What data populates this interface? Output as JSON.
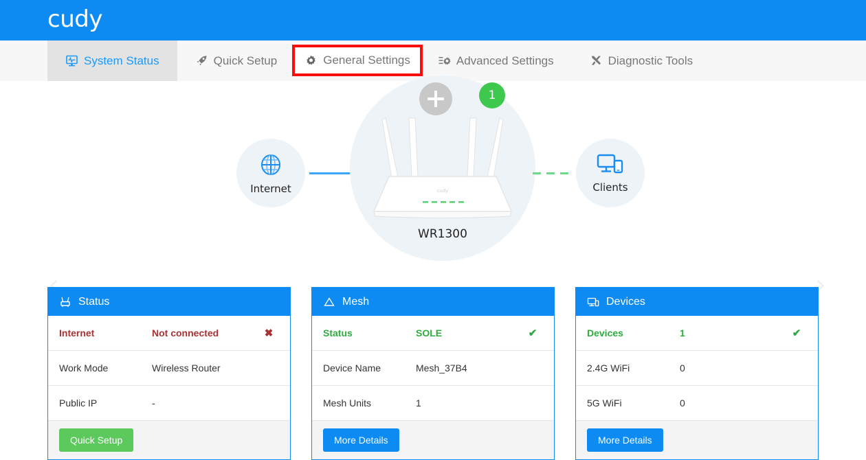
{
  "brand": {
    "logo_text": "cudy"
  },
  "nav": {
    "tabs": [
      {
        "label": "System Status",
        "icon": "monitor-pulse-icon",
        "state": "active"
      },
      {
        "label": "Quick Setup",
        "icon": "rocket-icon",
        "state": "normal"
      },
      {
        "label": "General Settings",
        "icon": "gear-icon",
        "state": "highlighted"
      },
      {
        "label": "Advanced Settings",
        "icon": "sliders-gear-icon",
        "state": "normal"
      },
      {
        "label": "Diagnostic Tools",
        "icon": "tools-icon",
        "state": "normal"
      }
    ],
    "highlight_color": "#fc0d0d",
    "active_color": "#1a9bfc"
  },
  "topology": {
    "prev_arrow": "‹",
    "next_arrow": "›",
    "internet": {
      "label": "Internet",
      "icon": "globe-icon"
    },
    "clients": {
      "label": "Clients",
      "icon": "monitor-tablet-icon"
    },
    "router": {
      "name": "WR1300",
      "logo_text": "cudy",
      "add_button_icon": "plus-icon",
      "client_count": "1",
      "antennas": 4,
      "led_count": 5
    },
    "links": {
      "wan": {
        "style": "solid",
        "color": "#3ba6f7"
      },
      "lan": {
        "style": "dashed",
        "color": "#6fd98a"
      }
    }
  },
  "cards": [
    {
      "title": "Status",
      "icon": "router-icon",
      "rows": [
        {
          "label": "Internet",
          "value": "Not connected",
          "mark": "✖",
          "state": "bad"
        },
        {
          "label": "Work Mode",
          "value": "Wireless Router",
          "mark": "",
          "state": "normal"
        },
        {
          "label": "Public IP",
          "value": "-",
          "mark": "",
          "state": "normal"
        }
      ],
      "button": {
        "label": "Quick Setup",
        "style": "green"
      }
    },
    {
      "title": "Mesh",
      "icon": "mesh-triangle-icon",
      "rows": [
        {
          "label": "Status",
          "value": "SOLE",
          "mark": "✔",
          "state": "good"
        },
        {
          "label": "Device Name",
          "value": "Mesh_37B4",
          "mark": "",
          "state": "normal"
        },
        {
          "label": "Mesh Units",
          "value": "1",
          "mark": "",
          "state": "normal"
        }
      ],
      "button": {
        "label": "More Details",
        "style": "blue"
      }
    },
    {
      "title": "Devices",
      "icon": "devices-icon",
      "rows": [
        {
          "label": "Devices",
          "value": "1",
          "mark": "✔",
          "state": "good"
        },
        {
          "label": "2.4G WiFi",
          "value": "0",
          "mark": "",
          "state": "normal"
        },
        {
          "label": "5G WiFi",
          "value": "0",
          "mark": "",
          "state": "normal"
        }
      ],
      "button": {
        "label": "More Details",
        "style": "blue"
      }
    }
  ],
  "colors": {
    "brand_blue": "#0d8bf2",
    "nav_bg": "#f7f7f7",
    "active_tab_bg": "#e3e3e3",
    "halo": "#eef3f8",
    "green": "#3ec94e",
    "bad_red": "#a83232",
    "good_green": "#2faa3f"
  }
}
